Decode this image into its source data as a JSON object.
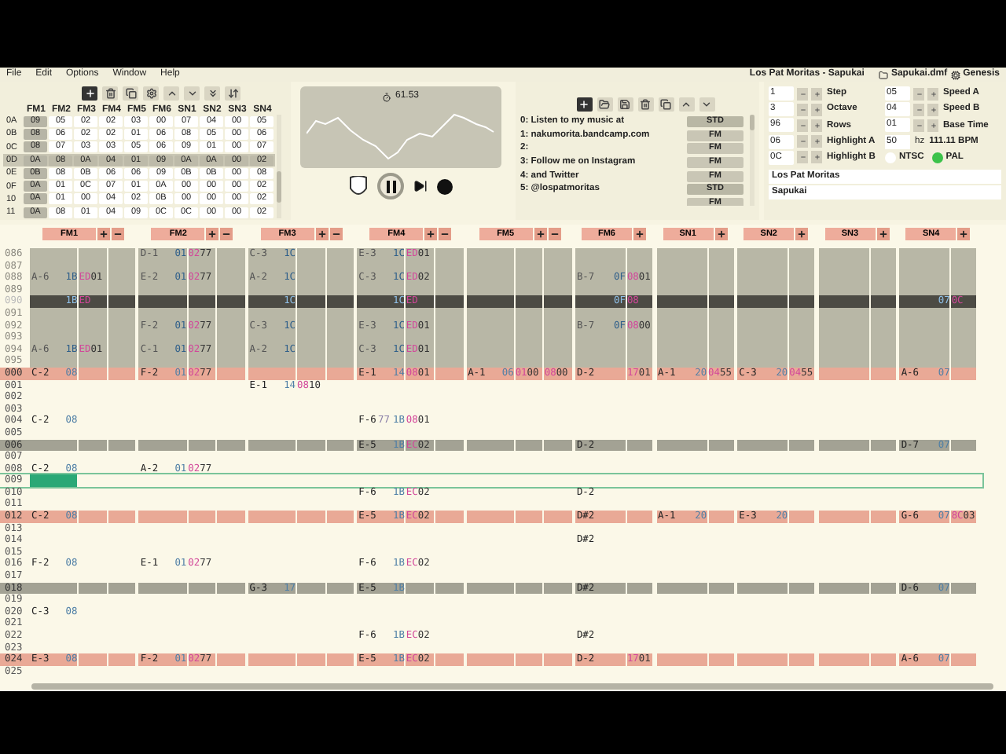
{
  "menu": [
    "File",
    "Edit",
    "Options",
    "Window",
    "Help"
  ],
  "title": {
    "song": "Los Pat Moritas - Sapukai",
    "file": "Sapukai.dmf",
    "system": "Genesis"
  },
  "orders": {
    "columns": [
      "FM1",
      "FM2",
      "FM3",
      "FM4",
      "FM5",
      "FM6",
      "SN1",
      "SN2",
      "SN3",
      "SN4"
    ],
    "rows": [
      {
        "label": "0A",
        "values": [
          "09",
          "05",
          "02",
          "02",
          "03",
          "00",
          "07",
          "04",
          "00",
          "05"
        ],
        "selected": false
      },
      {
        "label": "0B",
        "values": [
          "08",
          "06",
          "02",
          "02",
          "01",
          "06",
          "08",
          "05",
          "00",
          "06"
        ],
        "selected": false
      },
      {
        "label": "0C",
        "values": [
          "08",
          "07",
          "03",
          "03",
          "05",
          "06",
          "09",
          "01",
          "00",
          "07"
        ],
        "selected": false
      },
      {
        "label": "0D",
        "values": [
          "0A",
          "08",
          "0A",
          "04",
          "01",
          "09",
          "0A",
          "0A",
          "00",
          "02"
        ],
        "selected": true
      },
      {
        "label": "0E",
        "values": [
          "0B",
          "08",
          "0B",
          "06",
          "06",
          "09",
          "0B",
          "0B",
          "00",
          "08"
        ],
        "selected": false
      },
      {
        "label": "0F",
        "values": [
          "0A",
          "01",
          "0C",
          "07",
          "01",
          "0A",
          "00",
          "00",
          "00",
          "02"
        ],
        "selected": false
      },
      {
        "label": "10",
        "values": [
          "0A",
          "01",
          "00",
          "04",
          "02",
          "0B",
          "00",
          "00",
          "00",
          "02"
        ],
        "selected": false
      },
      {
        "label": "11",
        "values": [
          "0A",
          "08",
          "01",
          "04",
          "09",
          "0C",
          "0C",
          "00",
          "00",
          "02"
        ],
        "selected": false
      }
    ]
  },
  "oscilloscope": {
    "time": "61.53"
  },
  "transport": {
    "playing": true
  },
  "instruments": [
    {
      "label": "0: Listen to my music at",
      "type": "STD"
    },
    {
      "label": "1: nakumorita.bandcamp.com",
      "type": "FM"
    },
    {
      "label": "2:",
      "type": "FM"
    },
    {
      "label": "3: Follow me on Instagram",
      "type": "FM"
    },
    {
      "label": "4: and Twitter",
      "type": "FM"
    },
    {
      "label": "5: @lospatmoritas",
      "type": "STD"
    },
    {
      "type": "FM"
    }
  ],
  "song": {
    "left": [
      {
        "value": "1",
        "label": "Step"
      },
      {
        "value": "3",
        "label": "Octave"
      },
      {
        "value": "96",
        "label": "Rows"
      },
      {
        "value": "06",
        "label": "Highlight A"
      },
      {
        "value": "0C",
        "label": "Highlight B"
      }
    ],
    "right": [
      {
        "value": "05",
        "label": "Speed A"
      },
      {
        "value": "04",
        "label": "Speed B"
      },
      {
        "value": "01",
        "label": "Base Time"
      }
    ],
    "tempo": {
      "value": "50",
      "unit": "hz",
      "bpm": "111.11 BPM"
    },
    "video": [
      {
        "label": "NTSC",
        "selected": false
      },
      {
        "label": "PAL",
        "selected": true
      }
    ],
    "name": "Los Pat Moritas",
    "author": "Sapukai"
  },
  "pattern": {
    "channels": [
      {
        "name": "FM1",
        "kind": "wide",
        "collapse_button": true
      },
      {
        "name": "FM2",
        "kind": "wide",
        "collapse_button": true
      },
      {
        "name": "FM3",
        "kind": "wide",
        "collapse_button": true
      },
      {
        "name": "FM4",
        "kind": "wide",
        "collapse_button": true
      },
      {
        "name": "FM5",
        "kind": "wide",
        "collapse_button": true
      },
      {
        "name": "FM6",
        "kind": "narrow",
        "collapse_button": false
      },
      {
        "name": "SN1",
        "kind": "narrow",
        "collapse_button": false
      },
      {
        "name": "SN2",
        "kind": "narrow",
        "collapse_button": false
      },
      {
        "name": "SN3",
        "kind": "narrow",
        "collapse_button": false
      },
      {
        "name": "SN4",
        "kind": "narrow",
        "collapse_button": false
      }
    ],
    "rows": [
      {
        "number": "086",
        "kind": "previous",
        "cells": [
          {},
          {
            "note": "D-1",
            "ins": "01",
            "fx": [
              {
                "code": "02",
                "value": "77"
              }
            ]
          },
          {
            "note": "C-3",
            "ins": "1C"
          },
          {
            "note": "E-3",
            "ins": "1C",
            "fx": [
              {
                "code": "ED",
                "value": "01"
              }
            ]
          },
          {},
          {},
          {},
          {},
          {},
          {}
        ]
      },
      {
        "number": "087",
        "kind": "previous"
      },
      {
        "number": "088",
        "kind": "previous",
        "cells": [
          {
            "note": "A-6",
            "ins": "1B",
            "fx": [
              {
                "code": "ED",
                "value": "01"
              }
            ]
          },
          {
            "note": "E-2",
            "ins": "01",
            "fx": [
              {
                "code": "02",
                "value": "77"
              }
            ]
          },
          {
            "note": "A-2",
            "ins": "1C"
          },
          {
            "note": "C-3",
            "ins": "1C",
            "fx": [
              {
                "code": "ED",
                "value": "02"
              }
            ]
          },
          {},
          {
            "note": "B-7",
            "ins": "0F",
            "fx": [
              {
                "code": "08",
                "value": "01"
              }
            ]
          },
          {},
          {},
          {},
          {}
        ]
      },
      {
        "number": "089",
        "kind": "previous"
      },
      {
        "number": "090",
        "kind": "previous_highlight",
        "cells": [
          {
            "ins": "1B",
            "fx": [
              {
                "code": "ED"
              }
            ]
          },
          {},
          {
            "ins": "1C"
          },
          {
            "ins": "1C",
            "fx": [
              {
                "code": "ED"
              }
            ]
          },
          {},
          {
            "ins": "0F",
            "fx": [
              {
                "code": "08"
              }
            ]
          },
          {},
          {},
          {},
          {
            "ins": "07",
            "fx": [
              {
                "code": "0C"
              }
            ]
          }
        ]
      },
      {
        "number": "091",
        "kind": "previous"
      },
      {
        "number": "092",
        "kind": "previous",
        "cells": [
          {},
          {
            "note": "F-2",
            "ins": "01",
            "fx": [
              {
                "code": "02",
                "value": "77"
              }
            ]
          },
          {
            "note": "C-3",
            "ins": "1C"
          },
          {
            "note": "E-3",
            "ins": "1C",
            "fx": [
              {
                "code": "ED",
                "value": "01"
              }
            ]
          },
          {},
          {
            "note": "B-7",
            "ins": "0F",
            "fx": [
              {
                "code": "08",
                "value": "00"
              }
            ]
          },
          {},
          {},
          {},
          {}
        ]
      },
      {
        "number": "093",
        "kind": "previous"
      },
      {
        "number": "094",
        "kind": "previous",
        "cells": [
          {
            "note": "A-6",
            "ins": "1B",
            "fx": [
              {
                "code": "ED",
                "value": "01"
              }
            ]
          },
          {
            "note": "C-1",
            "ins": "01",
            "fx": [
              {
                "code": "02",
                "value": "77"
              }
            ]
          },
          {
            "note": "A-2",
            "ins": "1C"
          },
          {
            "note": "C-3",
            "ins": "1C",
            "fx": [
              {
                "code": "ED",
                "value": "01"
              }
            ]
          },
          {},
          {},
          {},
          {},
          {},
          {}
        ]
      },
      {
        "number": "095",
        "kind": "previous"
      },
      {
        "number": "000",
        "kind": "highlight_b",
        "cells": [
          {
            "note": "C-2",
            "ins": "08"
          },
          {
            "note": "F-2",
            "ins": "01",
            "fx": [
              {
                "code": "02",
                "value": "77"
              }
            ]
          },
          {},
          {
            "note": "E-1",
            "ins": "14",
            "fx": [
              {
                "code": "08",
                "value": "01"
              }
            ]
          },
          {
            "note": "A-1",
            "ins": "06",
            "fx": [
              {
                "code": "01",
                "value": "00"
              },
              {
                "code": "08",
                "value": "00"
              }
            ]
          },
          {
            "note": "D-2",
            "fx": [
              {
                "code": "17",
                "value": "01"
              }
            ]
          },
          {
            "note": "A-1",
            "ins": "20",
            "fx": [
              {
                "code": "04",
                "value": "55"
              }
            ]
          },
          {
            "note": "C-3",
            "ins": "20",
            "fx": [
              {
                "code": "04",
                "value": "55"
              }
            ]
          },
          {},
          {
            "note": "A-6",
            "ins": "07"
          }
        ]
      },
      {
        "number": "001",
        "kind": "normal",
        "cells": [
          {},
          {},
          {
            "note": "E-1",
            "ins": "14",
            "fx": [
              {
                "code": "08",
                "value": "10"
              }
            ]
          },
          {},
          {},
          {},
          {},
          {},
          {},
          {}
        ]
      },
      {
        "number": "002",
        "kind": "normal"
      },
      {
        "number": "003",
        "kind": "normal"
      },
      {
        "number": "004",
        "kind": "normal",
        "cells": [
          {
            "note": "C-2",
            "ins": "08"
          },
          {},
          {},
          {
            "note": "F-6",
            "vol": "77",
            "ins": "1B",
            "fx": [
              {
                "code": "08",
                "value": "01"
              }
            ]
          },
          {},
          {},
          {},
          {},
          {},
          {}
        ]
      },
      {
        "number": "005",
        "kind": "normal"
      },
      {
        "number": "006",
        "kind": "highlight_a",
        "cells": [
          {},
          {},
          {},
          {
            "note": "E-5",
            "ins": "1B",
            "fx": [
              {
                "code": "EC",
                "value": "02"
              }
            ]
          },
          {},
          {
            "note": "D-2"
          },
          {},
          {},
          {},
          {
            "note": "D-7",
            "ins": "07"
          }
        ]
      },
      {
        "number": "007",
        "kind": "normal"
      },
      {
        "number": "008",
        "kind": "normal",
        "cells": [
          {
            "note": "C-2",
            "ins": "08"
          },
          {
            "note": "A-2",
            "ins": "01",
            "fx": [
              {
                "code": "02",
                "value": "77"
              }
            ]
          },
          {},
          {},
          {},
          {},
          {},
          {},
          {},
          {}
        ]
      },
      {
        "number": "009",
        "kind": "cursor"
      },
      {
        "number": "010",
        "kind": "normal",
        "cells": [
          {},
          {},
          {},
          {
            "note": "F-6",
            "ins": "1B",
            "fx": [
              {
                "code": "EC",
                "value": "02"
              }
            ]
          },
          {},
          {
            "note": "D-2"
          },
          {},
          {},
          {},
          {}
        ]
      },
      {
        "number": "011",
        "kind": "normal"
      },
      {
        "number": "012",
        "kind": "highlight_b",
        "cells": [
          {
            "note": "C-2",
            "ins": "08"
          },
          {},
          {},
          {
            "note": "E-5",
            "ins": "1B",
            "fx": [
              {
                "code": "EC",
                "value": "02"
              }
            ]
          },
          {},
          {
            "note": "D#2"
          },
          {
            "note": "A-1",
            "ins": "20"
          },
          {
            "note": "E-3",
            "ins": "20"
          },
          {},
          {
            "note": "G-6",
            "ins": "07",
            "fx": [
              {
                "code": "8C",
                "value": "03"
              }
            ]
          }
        ]
      },
      {
        "number": "013",
        "kind": "normal"
      },
      {
        "number": "014",
        "kind": "normal",
        "cells": [
          {},
          {},
          {},
          {},
          {},
          {
            "note": "D#2"
          },
          {},
          {},
          {},
          {}
        ]
      },
      {
        "number": "015",
        "kind": "normal"
      },
      {
        "number": "016",
        "kind": "normal",
        "cells": [
          {
            "note": "F-2",
            "ins": "08"
          },
          {
            "note": "E-1",
            "ins": "01",
            "fx": [
              {
                "code": "02",
                "value": "77"
              }
            ]
          },
          {},
          {
            "note": "F-6",
            "ins": "1B",
            "fx": [
              {
                "code": "EC",
                "value": "02"
              }
            ]
          },
          {},
          {},
          {},
          {},
          {},
          {}
        ]
      },
      {
        "number": "017",
        "kind": "normal"
      },
      {
        "number": "018",
        "kind": "highlight_a",
        "cells": [
          {},
          {},
          {
            "note": "G-3",
            "ins": "17"
          },
          {
            "note": "E-5",
            "ins": "1B"
          },
          {},
          {
            "note": "D#2"
          },
          {},
          {},
          {},
          {
            "note": "D-6",
            "ins": "07"
          }
        ]
      },
      {
        "number": "019",
        "kind": "normal"
      },
      {
        "number": "020",
        "kind": "normal",
        "cells": [
          {
            "note": "C-3",
            "ins": "08"
          },
          {},
          {},
          {},
          {},
          {},
          {},
          {},
          {},
          {}
        ]
      },
      {
        "number": "021",
        "kind": "normal"
      },
      {
        "number": "022",
        "kind": "normal",
        "cells": [
          {},
          {},
          {},
          {
            "note": "F-6",
            "ins": "1B",
            "fx": [
              {
                "code": "EC",
                "value": "02"
              }
            ]
          },
          {},
          {
            "note": "D#2"
          },
          {},
          {},
          {},
          {}
        ]
      },
      {
        "number": "023",
        "kind": "normal"
      },
      {
        "number": "024",
        "kind": "highlight_b",
        "cells": [
          {
            "note": "E-3",
            "ins": "08"
          },
          {
            "note": "F-2",
            "ins": "01",
            "fx": [
              {
                "code": "02",
                "value": "77"
              }
            ]
          },
          {},
          {
            "note": "E-5",
            "ins": "1B",
            "fx": [
              {
                "code": "EC",
                "value": "02"
              }
            ]
          },
          {},
          {
            "note": "D-2",
            "fx": [
              {
                "code": "17",
                "value": "01"
              }
            ]
          },
          {},
          {},
          {},
          {
            "note": "A-6",
            "ins": "07"
          }
        ]
      },
      {
        "number": "025",
        "kind": "normal"
      }
    ]
  }
}
